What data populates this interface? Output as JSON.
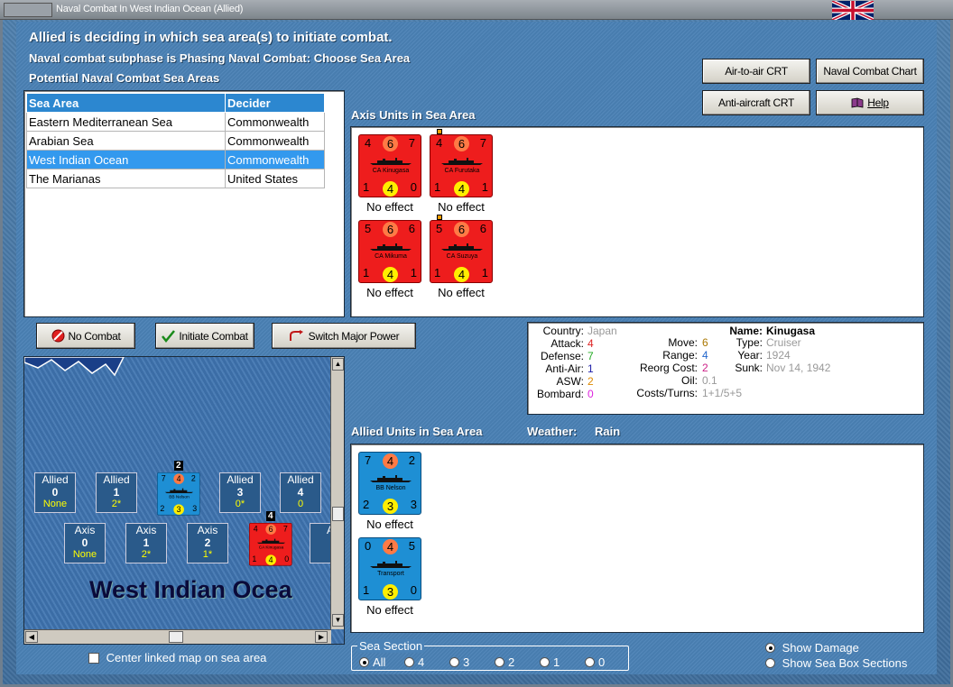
{
  "window": {
    "title": "Naval Combat In West Indian Ocean (Allied)"
  },
  "header": {
    "line1": "Allied is deciding in which sea area(s) to initiate combat.",
    "line2": "Naval combat subphase is Phasing Naval Combat: Choose Sea Area",
    "line3": "Potential Naval Combat Sea Areas"
  },
  "buttons": {
    "air_to_air": "Air-to-air CRT",
    "naval_chart": "Naval Combat Chart",
    "anti_aircraft": "Anti-aircraft CRT",
    "help": "Help",
    "no_combat": "No Combat",
    "initiate": "Initiate Combat",
    "switch": "Switch Major Power"
  },
  "sea_table": {
    "headers": [
      "Sea Area",
      "Decider"
    ],
    "rows": [
      [
        "Eastern Mediterranean Sea",
        "Commonwealth"
      ],
      [
        "Arabian Sea",
        "Commonwealth"
      ],
      [
        "West Indian Ocean",
        "Commonwealth"
      ],
      [
        "The Marianas",
        "United States"
      ]
    ],
    "selected": 2
  },
  "axis_section": {
    "title": "Axis Units in Sea Area"
  },
  "axis_units": [
    {
      "tl": "4",
      "tc": "6",
      "tr": "7",
      "name": "CA Kinugasa",
      "bl": "1",
      "bc": "4",
      "br": "0",
      "status": "No effect"
    },
    {
      "tl": "4",
      "tc": "6",
      "tr": "7",
      "name": "CA Furutaka",
      "bl": "1",
      "bc": "4",
      "br": "1",
      "status": "No effect"
    },
    {
      "tl": "5",
      "tc": "6",
      "tr": "6",
      "name": "CA Mikuma",
      "bl": "1",
      "bc": "4",
      "br": "1",
      "status": "No effect"
    },
    {
      "tl": "5",
      "tc": "6",
      "tr": "6",
      "name": "CA Suzuya",
      "bl": "1",
      "bc": "4",
      "br": "1",
      "status": "No effect"
    }
  ],
  "details": {
    "country_l": "Country:",
    "country": "Japan",
    "attack_l": "Attack:",
    "attack": "4",
    "defense_l": "Defense:",
    "defense": "7",
    "aa_l": "Anti-Air:",
    "aa": "1",
    "asw_l": "ASW:",
    "asw": "2",
    "bomb_l": "Bombard:",
    "bomb": "0",
    "move_l": "Move:",
    "move": "6",
    "range_l": "Range:",
    "range": "4",
    "reorg_l": "Reorg Cost:",
    "reorg": "2",
    "oil_l": "Oil:",
    "oil": "0.1",
    "costs_l": "Costs/Turns:",
    "costs": "1+1/5+5",
    "name_l": "Name:",
    "name": "Kinugasa",
    "type_l": "Type:",
    "type": "Cruiser",
    "year_l": "Year:",
    "year": "1924",
    "sunk_l": "Sunk:",
    "sunk": "Nov 14, 1942"
  },
  "allied_section": {
    "title": "Allied Units in Sea Area",
    "weather_label": "Weather:",
    "weather": "Rain"
  },
  "allied_units": [
    {
      "tl": "7",
      "tc": "4",
      "tr": "2",
      "name": "BB Nelson",
      "bl": "2",
      "bc": "3",
      "br": "3",
      "status": "No effect"
    },
    {
      "tl": "0",
      "tc": "4",
      "tr": "5",
      "name": "Transport",
      "bl": "1",
      "bc": "3",
      "br": "0",
      "status": "No effect"
    }
  ],
  "map": {
    "sea_name": "West Indian Ocea",
    "allied_boxes": [
      {
        "title": "Allied",
        "num": "0",
        "sub": "None"
      },
      {
        "title": "Allied",
        "num": "1",
        "sub": "2*"
      },
      {
        "title": "Allied",
        "num": "3",
        "sub": "0*"
      },
      {
        "title": "Allied",
        "num": "4",
        "sub": "0"
      }
    ],
    "axis_boxes": [
      {
        "title": "Axis",
        "num": "0",
        "sub": "None"
      },
      {
        "title": "Axis",
        "num": "1",
        "sub": "2*"
      },
      {
        "title": "Axis",
        "num": "2",
        "sub": "1*"
      },
      {
        "title": "A",
        "num": "",
        "sub": ""
      }
    ],
    "stack_nelson": "2",
    "stack_kinugasa": "4",
    "mini_nelson": {
      "tl": "7",
      "tc": "4",
      "tr": "2",
      "name": "BB Nelson",
      "bl": "2",
      "bc": "3",
      "br": "3"
    },
    "mini_kinugasa": {
      "tl": "4",
      "tc": "6",
      "tr": "7",
      "name": "CA Kinugasa",
      "bl": "1",
      "bc": "4",
      "br": "0"
    }
  },
  "center_linked": "Center linked map on sea area",
  "sea_section": {
    "title": "Sea Section",
    "options": [
      "All",
      "4",
      "3",
      "2",
      "1",
      "0"
    ]
  },
  "show_damage": "Show Damage",
  "show_sea_box": "Show Sea Box Sections",
  "colors": {
    "axis_red": "#ee1d1d",
    "allied_blue": "#1e8fd4",
    "attack": "#dd2222",
    "defense": "#22aa22",
    "move": "#aa7700"
  }
}
